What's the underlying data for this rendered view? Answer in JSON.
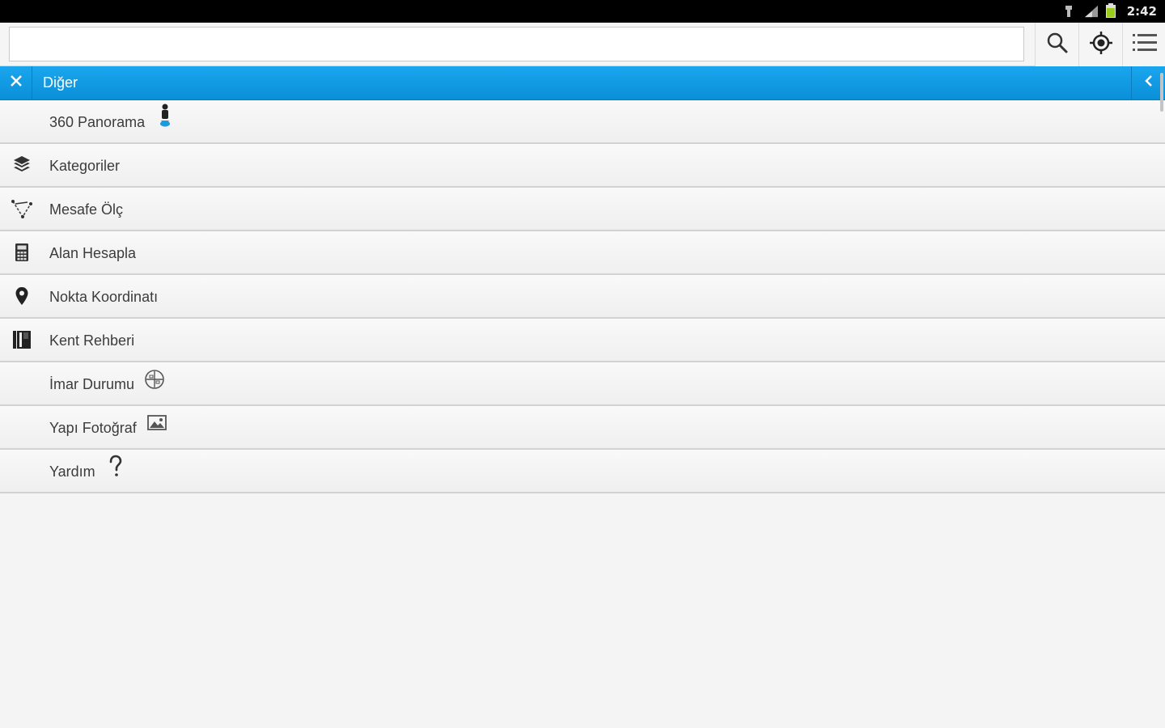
{
  "status_bar": {
    "time": "2:42",
    "icons": [
      "usb-icon",
      "signal-icon",
      "battery-icon"
    ]
  },
  "toolbar": {
    "search_value": "",
    "search_placeholder": "",
    "buttons": [
      "search-icon",
      "locate-icon",
      "menu-icon"
    ]
  },
  "header": {
    "title": "Diğer",
    "close_icon": "close-icon",
    "back_icon": "chevron-left-icon",
    "accent_color": "#0a8fd9"
  },
  "menu": {
    "items": [
      {
        "label": "360 Panorama",
        "left_icon": "",
        "trail_icon": "pegman-icon"
      },
      {
        "label": "Kategoriler",
        "left_icon": "layers-icon",
        "trail_icon": ""
      },
      {
        "label": "Mesafe Ölç",
        "left_icon": "ruler-measure-icon",
        "trail_icon": ""
      },
      {
        "label": "Alan Hesapla",
        "left_icon": "calculator-icon",
        "trail_icon": ""
      },
      {
        "label": "Nokta Koordinatı",
        "left_icon": "map-pin-icon",
        "trail_icon": ""
      },
      {
        "label": "Kent Rehberi",
        "left_icon": "book-icon",
        "trail_icon": ""
      },
      {
        "label": "İmar Durumu",
        "left_icon": "",
        "trail_icon": "zoning-icon"
      },
      {
        "label": "Yapı Fotoğraf",
        "left_icon": "",
        "trail_icon": "photo-icon"
      },
      {
        "label": "Yardım",
        "left_icon": "",
        "trail_icon": "question-icon"
      }
    ]
  }
}
